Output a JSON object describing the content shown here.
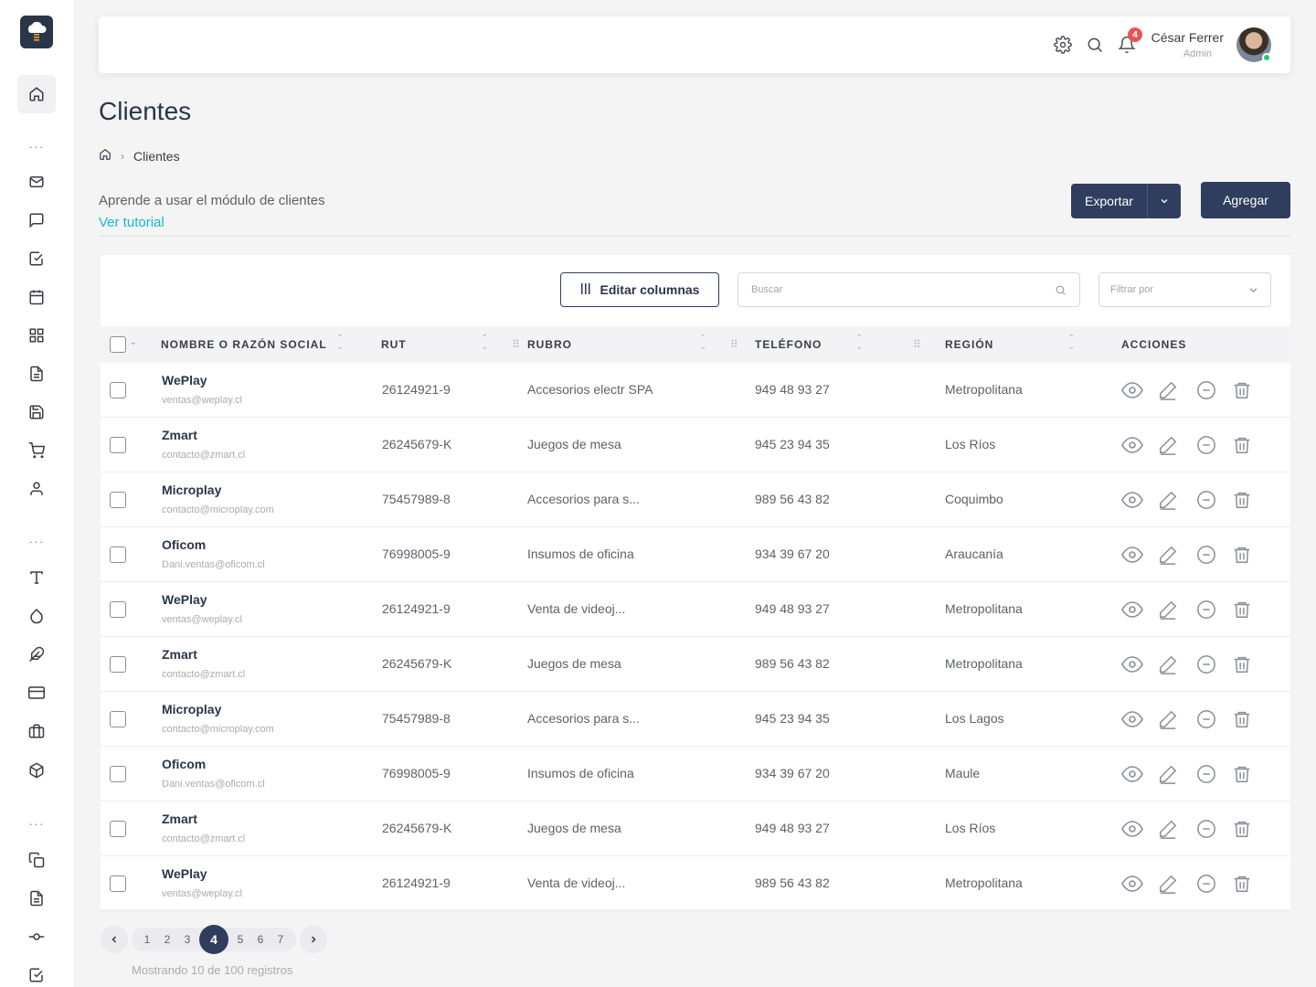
{
  "sidebar": {
    "logo": "cloud-logo",
    "icons": [
      "home-icon",
      "mail-icon",
      "chat-icon",
      "checkbox-icon",
      "calendar-icon",
      "grid-icon",
      "document-icon",
      "save-icon",
      "cart-icon",
      "user-icon",
      "type-icon",
      "droplet-icon",
      "feather-icon",
      "credit-card-icon",
      "briefcase-icon",
      "box-icon",
      "copy-icon",
      "file-icon",
      "git-commit-icon",
      "check-square-icon"
    ]
  },
  "header": {
    "icons": [
      "settings-icon",
      "search-icon",
      "bell-icon"
    ],
    "notification_count": "4",
    "user_name": "César Ferrer",
    "user_role": "Admin"
  },
  "page": {
    "title": "Clientes",
    "breadcrumb_current": "Clientes",
    "help_text": "Aprende a usar el módulo de clientes",
    "help_link": "Ver tutorial",
    "export_label": "Exportar",
    "add_label": "Agregar"
  },
  "toolbar": {
    "edit_columns_label": "Editar columnas",
    "search_placeholder": "Buscar",
    "filter_placeholder": "Filtrar por"
  },
  "table": {
    "columns": [
      "NOMBRE O RAZÓN SOCIAL",
      "RUT",
      "RUBRO",
      "TELÉFONO",
      "REGIÓN",
      "ACCIONES"
    ],
    "rows": [
      {
        "name": "WePlay",
        "email": "ventas@weplay.cl",
        "rut": "26124921-9",
        "rubro": "Accesorios electr SPA",
        "telefono": "949 48 93 27",
        "region": "Metropolitana"
      },
      {
        "name": "Zmart",
        "email": "contacto@zmart.cl",
        "rut": "26245679-K",
        "rubro": "Juegos de mesa",
        "telefono": "945 23 94 35",
        "region": "Los Ríos"
      },
      {
        "name": "Microplay",
        "email": "contacto@microplay.com",
        "rut": "75457989-8",
        "rubro": "Accesorios para s...",
        "telefono": "989 56 43 82",
        "region": "Coquimbo"
      },
      {
        "name": "Oficom",
        "email": "Dani.ventas@oficom.cl",
        "rut": "76998005-9",
        "rubro": "Insumos de oficina",
        "telefono": "934 39 67 20",
        "region": "Araucanía"
      },
      {
        "name": "WePlay",
        "email": "ventas@weplay.cl",
        "rut": "26124921-9",
        "rubro": "Venta de videoj...",
        "telefono": "949 48 93 27",
        "region": "Metropolitana"
      },
      {
        "name": "Zmart",
        "email": "contacto@zmart.cl",
        "rut": "26245679-K",
        "rubro": "Juegos de mesa",
        "telefono": "989 56 43 82",
        "region": "Metropolitana"
      },
      {
        "name": "Microplay",
        "email": "contacto@microplay.com",
        "rut": "75457989-8",
        "rubro": "Accesorios para s...",
        "telefono": "945 23 94 35",
        "region": "Los Lagos"
      },
      {
        "name": "Oficom",
        "email": "Dani.ventas@oficom.cl",
        "rut": "76998005-9",
        "rubro": "Insumos de oficina",
        "telefono": "934 39 67 20",
        "region": "Maule"
      },
      {
        "name": "Zmart",
        "email": "contacto@zmart.cl",
        "rut": "26245679-K",
        "rubro": "Juegos de mesa",
        "telefono": "949 48 93 27",
        "region": "Los Ríos"
      },
      {
        "name": "WePlay",
        "email": "ventas@weplay.cl",
        "rut": "26124921-9",
        "rubro": "Venta de videoj...",
        "telefono": "989 56 43 82",
        "region": "Metropolitana"
      }
    ],
    "row_actions": [
      "eye-icon",
      "edit-icon",
      "minus-circle-icon",
      "trash-icon"
    ]
  },
  "pagination": {
    "pages": [
      "1",
      "2",
      "3",
      "4",
      "5",
      "6",
      "7"
    ],
    "current": "4",
    "summary": "Mostrando 10 de 100 registros"
  },
  "colors": {
    "primary": "#2f3e5e",
    "link": "#14b8d3",
    "badge": "#ea5455",
    "online": "#28c76f"
  }
}
